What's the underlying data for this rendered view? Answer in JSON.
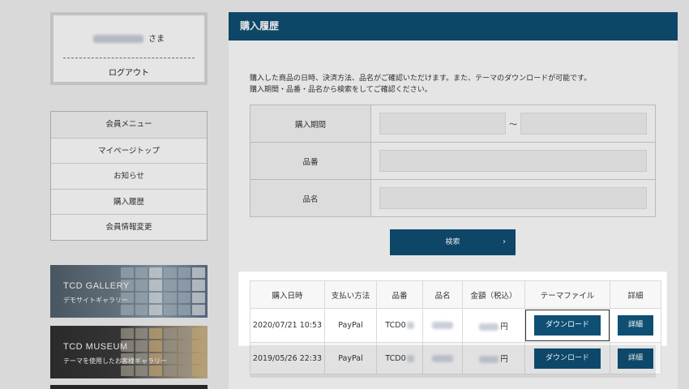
{
  "user": {
    "suffix": "さま",
    "logout": "ログアウト"
  },
  "menu": {
    "items": [
      "会員メニュー",
      "マイページトップ",
      "お知らせ",
      "購入履歴",
      "会員情報変更"
    ]
  },
  "banners": [
    {
      "title": "TCD GALLERY",
      "subtitle": "デモサイトギャラリー"
    },
    {
      "title": "TCD MUSEUM",
      "subtitle": "テーマを使用したお客様ギャラリー"
    }
  ],
  "panel": {
    "title": "購入履歴",
    "intro_line1": "購入した商品の日時、決済方法、品名がご確認いただけます。また、テーマのダウンロードが可能です。",
    "intro_line2": "購入期間・品番・品名から検索をしてご確認ください。"
  },
  "filter": {
    "period_label": "購入期間",
    "tilde": "～",
    "code_label": "品番",
    "name_label": "品名",
    "search_label": "検索",
    "chevron": "›"
  },
  "history": {
    "headers": [
      "購入日時",
      "支払い方法",
      "品番",
      "品名",
      "金額（税込）",
      "テーマファイル",
      "詳細"
    ],
    "rows": [
      {
        "date": "2020/07/21 10:53",
        "payment": "PayPal",
        "code": "TCD0",
        "yen": "円",
        "download": "ダウンロード",
        "detail": "詳細"
      },
      {
        "date": "2019/05/26 22:33",
        "payment": "PayPal",
        "code": "TCD0",
        "yen": "円",
        "download": "ダウンロード",
        "detail": "詳細"
      }
    ]
  },
  "colors": {
    "accent": "#0f4f73",
    "page_bg": "#f2f2f2"
  }
}
